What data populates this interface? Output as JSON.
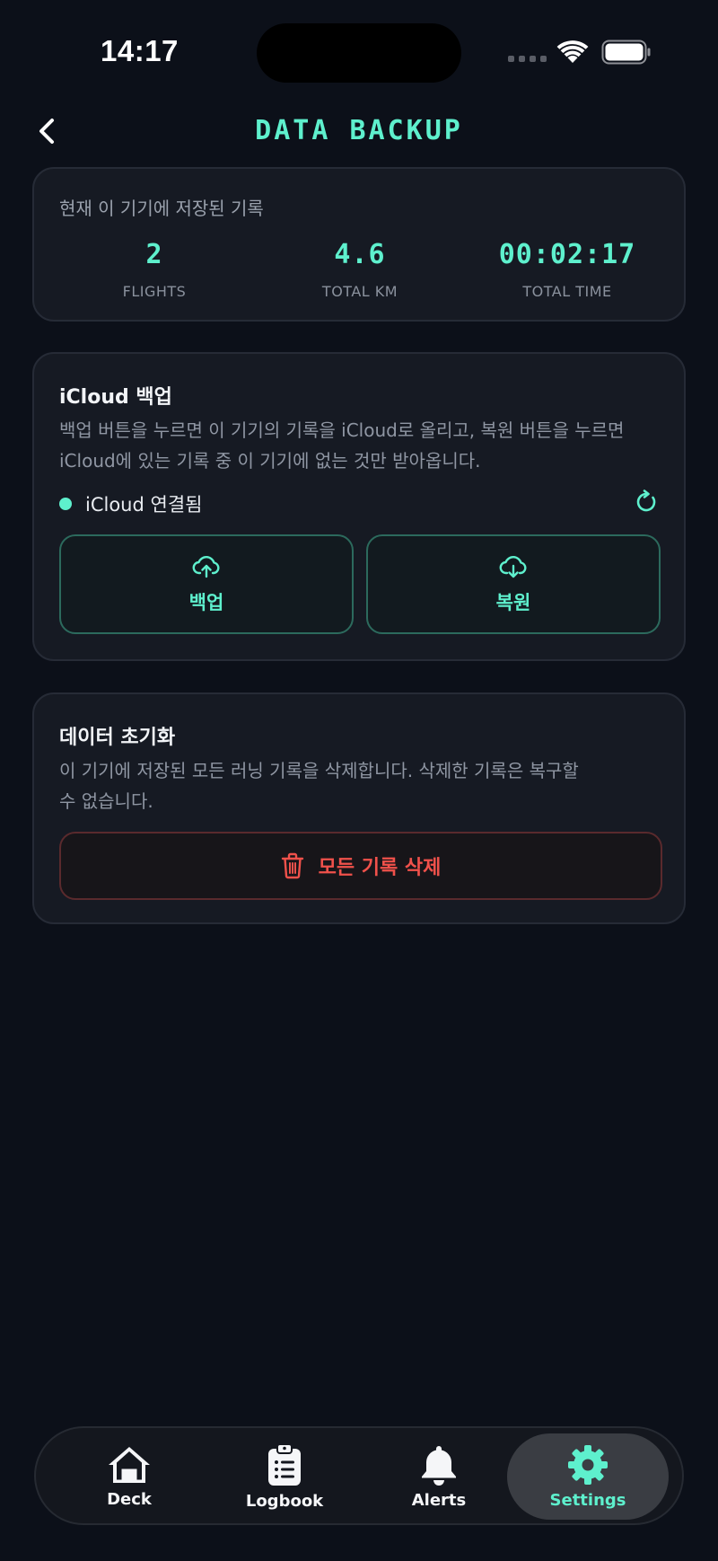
{
  "status_bar": {
    "time": "14:17"
  },
  "header": {
    "title": "DATA BACKUP"
  },
  "stats_card": {
    "caption": "현재 이 기기에 저장된 기록",
    "items": [
      {
        "value": "2",
        "label": "FLIGHTS"
      },
      {
        "value": "4.6",
        "label": "TOTAL KM"
      },
      {
        "value": "00:02:17",
        "label": "TOTAL TIME"
      }
    ]
  },
  "icloud_card": {
    "title": "iCloud 백업",
    "description_line1": "백업 버튼을 누르면 이 기기의 기록을 iCloud로 올리고, 복원 버튼을 누르면",
    "description_line2": "iCloud에 있는 기록 중 이 기기에 없는 것만 받아옵니다.",
    "status": "iCloud 연결됨",
    "backup_label": "백업",
    "restore_label": "복원"
  },
  "reset_card": {
    "title": "데이터 초기화",
    "description_line1": "이 기기에 저장된 모든 러닝 기록을 삭제합니다. 삭제한 기록은 복구할",
    "description_line2": "수 없습니다.",
    "delete_label": "모든 기록 삭제"
  },
  "tab_bar": {
    "tabs": [
      {
        "label": "Deck",
        "icon": "house-icon"
      },
      {
        "label": "Logbook",
        "icon": "clipboard-list-icon"
      },
      {
        "label": "Alerts",
        "icon": "bell-icon"
      },
      {
        "label": "Settings",
        "icon": "gear-icon"
      }
    ],
    "active": "Settings"
  },
  "colors": {
    "accent": "#5ef0cd",
    "danger": "#f0514b",
    "background": "#0c1019",
    "card": "#161a23"
  }
}
